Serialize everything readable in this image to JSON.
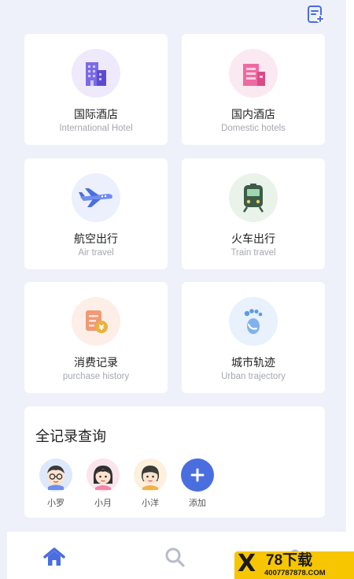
{
  "colors": {
    "background": "#eef0fa",
    "card": "#ffffff",
    "accent": "#4a6ee0",
    "title_text": "#222222",
    "subtitle_text": "#a5a8b0"
  },
  "header": {
    "icon": "add-note-icon"
  },
  "services": [
    {
      "title": "国际酒店",
      "subtitle": "International Hotel",
      "icon": "building-icon",
      "icon_bg": "#efe9fc"
    },
    {
      "title": "国内酒店",
      "subtitle": "Domestic hotels",
      "icon": "hotel-icon",
      "icon_bg": "#fbe9f2"
    },
    {
      "title": "航空出行",
      "subtitle": "Air travel",
      "icon": "airplane-icon",
      "icon_bg": "#ebf0fc"
    },
    {
      "title": "火车出行",
      "subtitle": "Train travel",
      "icon": "train-icon",
      "icon_bg": "#e9f3ea"
    },
    {
      "title": "消费记录",
      "subtitle": "purchase history",
      "icon": "receipt-icon",
      "icon_bg": "#fdeee7"
    },
    {
      "title": "城市轨迹",
      "subtitle": "Urban trajectory",
      "icon": "footprint-icon",
      "icon_bg": "#e8f1fc"
    }
  ],
  "records": {
    "title": "全记录查询",
    "people": [
      {
        "name": "小罗",
        "icon": "boy-avatar-icon"
      },
      {
        "name": "小月",
        "icon": "girl-avatar-icon"
      },
      {
        "name": "小洋",
        "icon": "girl-avatar-icon"
      },
      {
        "name": "添加",
        "icon": "plus-icon"
      }
    ]
  },
  "bottom_nav": [
    {
      "icon": "home-icon",
      "active": true
    },
    {
      "icon": "search-icon",
      "active": false
    },
    {
      "icon": "profile-icon",
      "active": false
    }
  ],
  "watermark": {
    "mark": "X",
    "brand": "78下载",
    "url": "4007787878.COM"
  }
}
